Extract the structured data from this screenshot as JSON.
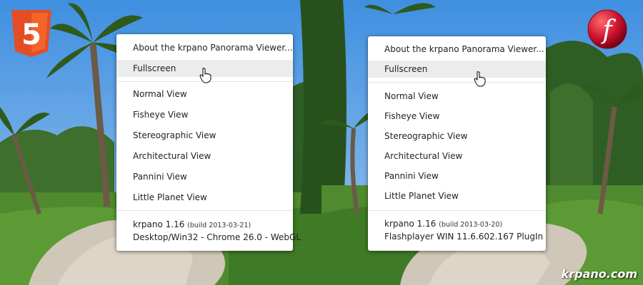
{
  "left_menu": {
    "about": "About the krpano Panorama Viewer...",
    "fullscreen": "Fullscreen",
    "views": [
      "Normal View",
      "Fisheye View",
      "Stereographic View",
      "Architectural View",
      "Pannini View",
      "Little Planet View"
    ],
    "version": "krpano 1.16",
    "build": "(build 2013-03-21)",
    "platform": "Desktop/Win32 - Chrome 26.0 - WebGL"
  },
  "right_menu": {
    "about": "About the krpano Panorama Viewer...",
    "fullscreen": "Fullscreen",
    "views": [
      "Normal View",
      "Fisheye View",
      "Stereographic View",
      "Architectural View",
      "Pannini View",
      "Little Planet View"
    ],
    "version": "krpano 1.16",
    "build": "(build 2013-03-20)",
    "platform": "Flashplayer WIN 11.6.602.167 PlugIn"
  },
  "html5_logo_text": "5",
  "flash_logo_text": "f",
  "brand": "krpano.com",
  "colors": {
    "html5": "#e44d26",
    "flash": "#c8102e",
    "sky": "#5aa0e0",
    "grass": "#4f8a2e",
    "path": "#cfc7b8"
  }
}
